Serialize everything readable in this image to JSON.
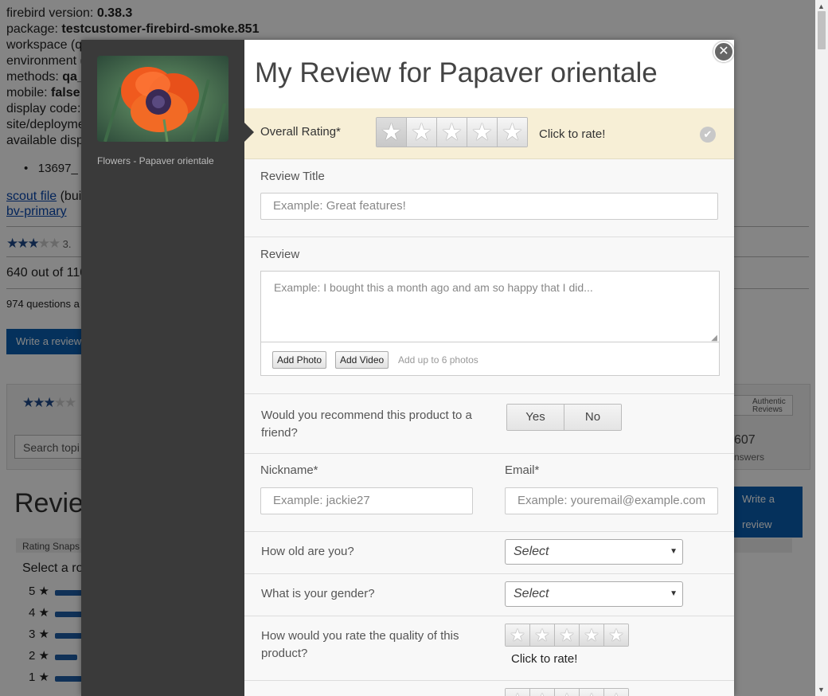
{
  "background": {
    "version_label": "firebird version: ",
    "version_value": "0.38.3",
    "package_label": "package: ",
    "package_value": "testcustomer-firebird-smoke.851",
    "workspace": "workspace (q",
    "environment": "environment (",
    "methods_label": "methods: ",
    "methods_value": "qa_",
    "mobile_label": "mobile: ",
    "mobile_value": "false",
    "display_code": "display code:",
    "site_deploy": "site/deployme",
    "available": "available disp",
    "list_item": "13697_",
    "scout_link": "scout file",
    "scout_rest": " (buil",
    "bv_link": "bv-primary",
    "rating_count": "3.",
    "recommend_text": "640 out of 110",
    "questions_text": "974 questions a",
    "write_review_btn": "Write a review",
    "search_placeholder": "Search topi",
    "answers_count": "607",
    "answers_label": "nswers",
    "authentic_1": "Authentic",
    "authentic_2": "Reviews",
    "reviews_heading": "Revie",
    "write_review_btn2": "Write a review",
    "rating_snapshot": "Rating Snaps",
    "select_row": "Select a ro",
    "bars": [
      "5",
      "4",
      "3",
      "2",
      "1"
    ]
  },
  "modal": {
    "title": "My Review for Papaver orientale",
    "close_glyph": "✕",
    "product_caption": "Flowers - Papaver orientale",
    "overall_rating_label": "Overall Rating*",
    "click_to_rate": "Click to rate!",
    "check_glyph": "✔",
    "review_title_label": "Review Title",
    "review_title_placeholder": "Example: Great features!",
    "review_label": "Review",
    "review_placeholder": "Example: I bought this a month ago and am so happy that I did...",
    "add_photo": "Add Photo",
    "add_video": "Add Video",
    "photo_hint": "Add up to 6 photos",
    "recommend_q": "Would you recommend this product to a friend?",
    "yes": "Yes",
    "no": "No",
    "nickname_label": "Nickname*",
    "nickname_placeholder": "Example: jackie27",
    "email_label": "Email*",
    "email_placeholder": "Example: youremail@example.com",
    "age_q": "How old are you?",
    "gender_q": "What is your gender?",
    "select_placeholder": "Select",
    "quality_q": "How would you rate the quality of this product?",
    "quality_click": "Click to rate!",
    "star_glyph": "★"
  }
}
